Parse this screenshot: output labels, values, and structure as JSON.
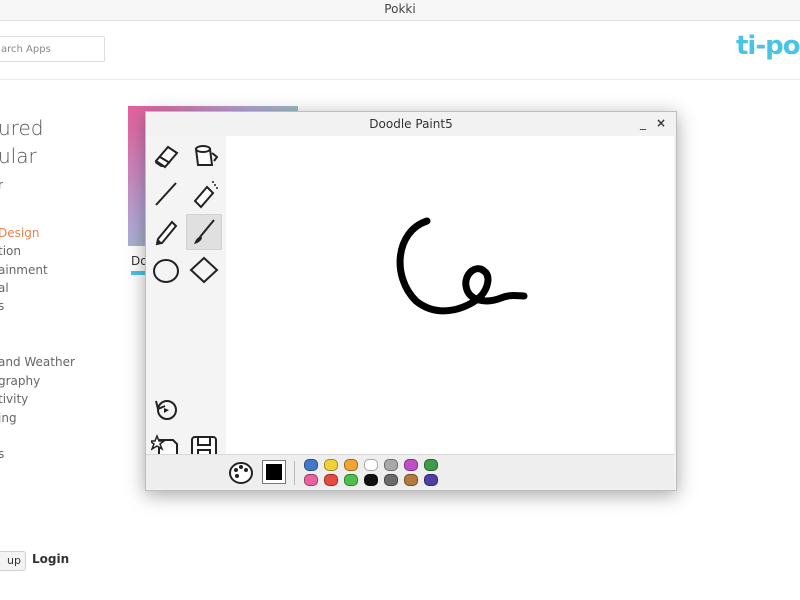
{
  "app": {
    "title": "Pokki"
  },
  "header": {
    "search_placeholder": "arch Apps",
    "logo_text": "ti-po"
  },
  "sidebar": {
    "primary": [
      "ured",
      "ular"
    ],
    "categories": [
      {
        "label": "Design",
        "active": true,
        "prefix": "&"
      },
      {
        "label": "tion",
        "active": false
      },
      {
        "label": "ainment",
        "active": false
      },
      {
        "label": "al",
        "active": false
      },
      {
        "label": "s",
        "active": false
      },
      {
        "label": "and Weather",
        "active": false
      },
      {
        "label": "graphy",
        "active": false
      },
      {
        "label": "tivity",
        "active": false
      },
      {
        "label": "ing",
        "active": false
      },
      {
        "label": "s",
        "active": false
      }
    ]
  },
  "footer": {
    "signup_label": "up",
    "login_label": "Login"
  },
  "background_card": {
    "label": "Do"
  },
  "doodle_window": {
    "title": "Doodle Paint5",
    "minimize_label": "_",
    "close_label": "×"
  },
  "colors": {
    "accent": "#e8834a",
    "brand": "#49c3e6",
    "palette_row1": [
      "#3f79c8",
      "#f1d338",
      "#f0a431",
      "#ffffff",
      "#a9a9a9",
      "#c04fc7",
      "#3d9b4a"
    ],
    "palette_row2": [
      "#e8639d",
      "#e74b3c",
      "#4cc24c",
      "#111111",
      "#6b6b6b",
      "#b37a3b",
      "#4e3fa3"
    ],
    "current_color": "#000000"
  }
}
